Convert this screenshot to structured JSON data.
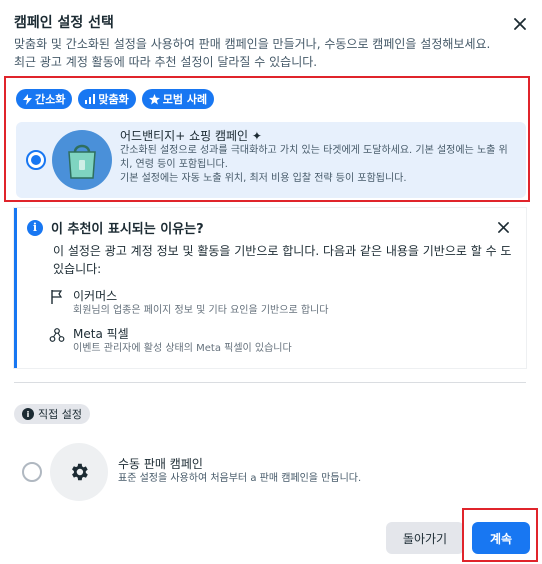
{
  "dialog": {
    "title": "캠페인 설정 선택",
    "subtitle": "맞춤화 및 간소화된 설정을 사용하여 판매 캠페인을 만들거나, 수동으로 캠페인을 설정해보세요. 최근 광고 계정 활동에 따라 추천 설정이 달라질 수 있습니다."
  },
  "recommended": {
    "pills": [
      {
        "label": "간소화",
        "icon": "lightning-icon"
      },
      {
        "label": "맞춤화",
        "icon": "bar-chart-icon"
      },
      {
        "label": "모범 사례",
        "icon": "star-icon"
      }
    ],
    "option": {
      "title": "어드밴티지+ 쇼핑 캠페인",
      "title_suffix": "✦",
      "desc1": "간소화된 설정으로 성과를 극대화하고 가치 있는 타겟에게 도달하세요. 기본 설정에는 노출 위치, 연령 등이 포함됩니다.",
      "desc2": "기본 설정에는 자동 노출 위치, 최저 비용 입찰 전략 등이 포함됩니다."
    }
  },
  "info": {
    "title": "이 추천이 표시되는 이유는?",
    "description": "이 설정은 광고 계정 정보 및 활동을 기반으로 합니다. 다음과 같은 내용을 기반으로 할 수 도 있습니다:",
    "reasons": [
      {
        "title": "이커머스",
        "desc": "회원님의 업종은 페이지 정보 및 기타 요인을 기반으로 합니다",
        "icon": "flag-icon"
      },
      {
        "title": "Meta 픽셀",
        "desc": "이벤트 관리자에 활성 상태의 Meta 픽셀이 있습니다",
        "icon": "pixel-nodes-icon"
      }
    ]
  },
  "manual": {
    "badge": "직접 설정",
    "title": "수동 판매 캠페인",
    "desc": "표준 설정을 사용하여 처음부터 a 판매 캠페인을 만듭니다."
  },
  "footer": {
    "back_label": "돌아가기",
    "next_label": "계속"
  },
  "colors": {
    "accent": "#1877f2",
    "highlight": "#e0242b",
    "selected_bg": "#e7f0fc"
  }
}
